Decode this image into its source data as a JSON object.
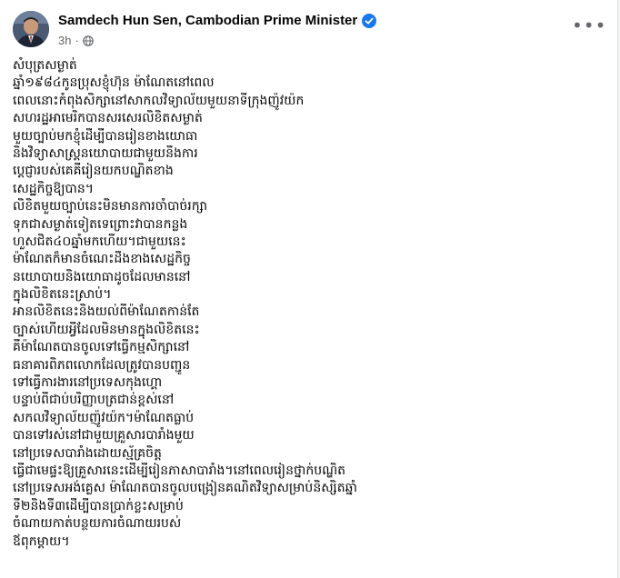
{
  "post": {
    "author": "Samdech Hun Sen, Cambodian Prime Minister",
    "time": "3h",
    "separator": "·",
    "more_label": "•••",
    "lines": [
      "សំបុត្រសម្ងាត់",
      "ឆ្នាំ១៩៨៤កូនប្រុសខ្ញុំហ៊ុន ម៉ាណែតនៅពេល",
      "ពេលនោះកំពុងសិក្សានៅសាកលវិទ្យាល័យមួយនាទីក្រុងញ៉ូវយ៉ក",
      "សហរដ្ឋអាមេរិកបានសរសេរលិខិតសម្ងាត់",
      "មួយច្បាប់មកខ្ញុំដើម្បីបានរៀនខាងយោធា",
      "និងវិទ្យាសាស្ត្រនយោបាយជាមួយនឹងការ",
      "ប្តេជ្ញារបស់គេគឺរៀនយកបណ្ឌិតខាង",
      "សេដ្ឋកិច្ចឱ្យបាន។",
      "លិខិតមួយច្បាប់នេះមិនមានការចាំបាច់រក្សា",
      "ទុកជាសម្ងាត់ទៀតទេព្រោះវាបានកន្លង",
      "ហួសជិត៤០ឆ្នាំមកហើយ។ជាមួយនេះ",
      "ម៉ាណែតក៏មានចំណេះដឹងខាងសេដ្ឋកិច្ច",
      "នយោបាយនិងយោធាដូចដែលមាននៅ",
      "ក្នុងលិខិតនេះស្រាប់។",
      "អានលិខិតនេះនិងយល់ពីម៉ាណែតកាន់តែ",
      "ច្បាស់ហើយអ្វីដែលមិនមានក្នុងលិខិតនេះ",
      "គឺម៉ាណែតបានចូលទៅធ្វើកម្មសិក្សានៅ",
      "ធនាគារពិភពលោកដែលត្រូវបានបញ្ជូន",
      "ទៅធ្វើការងារនៅប្រទេសកុងហ្គោ",
      "បន្ទាប់ពីជាប់បរិញ្ញាបត្រជាន់ខ្ពស់នៅ",
      "សកលវិទ្យាល័យញ៉ូវយ៉ក។ម៉ាណែតធ្លាប់",
      "បានទៅរស់នៅជាមួយគ្រួសារបារាំងមួយ",
      "នៅប្រទេសបារាំងដោយស្ម័គ្រចិត្ត",
      "ធ្វើជាមេផ្ទះឱ្យគ្រួសារនេះដើម្បីរៀនភាសាបារាំង។នៅពេលរៀនថ្នាក់បណ្ឌិត",
      "នៅប្រទេសអង់គ្លេស ម៉ាណែតបានចូលបង្រៀនគណិតវិទ្យាសម្រាប់និស្សិតឆ្នាំ",
      "ទី២និងទី៣ដើម្បីបានប្រាក់ខ្លះសម្រាប់",
      "ចំណាយកាត់បន្ថយការចំណាយរបស់",
      "ឪពុកម្តាយ។"
    ]
  },
  "icons": {
    "verified": "verified-badge-icon",
    "audience": "globe-icon",
    "more": "more-options-icon"
  },
  "colors": {
    "verified_blue": "#1877f2",
    "secondary_text": "#65676b",
    "primary_text": "#050505"
  }
}
